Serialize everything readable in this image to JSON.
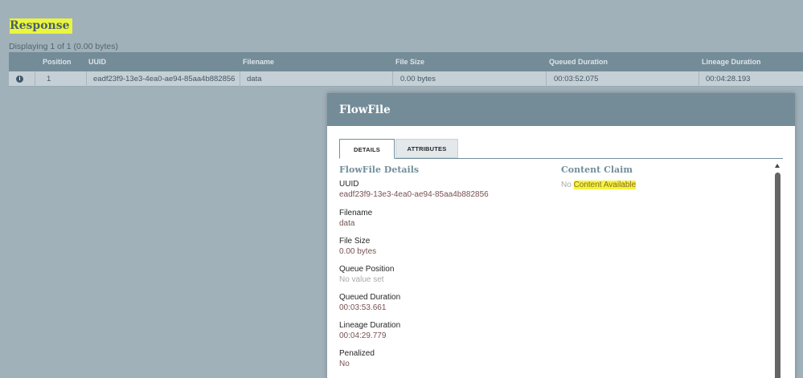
{
  "response": {
    "title": "Response",
    "displaying": "Displaying 1 of 1 (0.00 bytes)"
  },
  "table": {
    "headers": {
      "position": "Position",
      "uuid": "UUID",
      "filename": "Filename",
      "file_size": "File Size",
      "queued_duration": "Queued Duration",
      "lineage_duration": "Lineage Duration"
    },
    "row": {
      "position": "1",
      "uuid": "eadf23f9-13e3-4ea0-ae94-85aa4b882856",
      "filename": "data",
      "file_size": "0.00 bytes",
      "queued_duration": "00:03:52.075",
      "lineage_duration": "00:04:28.193"
    },
    "info_icon_glyph": "i"
  },
  "dialog": {
    "title": "FlowFile",
    "tabs": {
      "details": "DETAILS",
      "attributes": "ATTRIBUTES"
    },
    "details_title": "FlowFile Details",
    "fields": {
      "uuid_label": "UUID",
      "uuid_value": "eadf23f9-13e3-4ea0-ae94-85aa4b882856",
      "filename_label": "Filename",
      "filename_value": "data",
      "file_size_label": "File Size",
      "file_size_value": "0.00 bytes",
      "queue_position_label": "Queue Position",
      "queue_position_value": "No value set",
      "queued_duration_label": "Queued Duration",
      "queued_duration_value": "00:03:53.661",
      "lineage_duration_label": "Lineage Duration",
      "lineage_duration_value": "00:04:29.779",
      "penalized_label": "Penalized",
      "penalized_value": "No"
    },
    "content_claim_title": "Content Claim",
    "content_claim": {
      "prefix": "No ",
      "highlighted": "Content Available"
    }
  },
  "colors": {
    "background": "#a1b1ba",
    "header_bar": "#738c98",
    "highlight": "#f2f53b",
    "value_text": "#775351"
  }
}
